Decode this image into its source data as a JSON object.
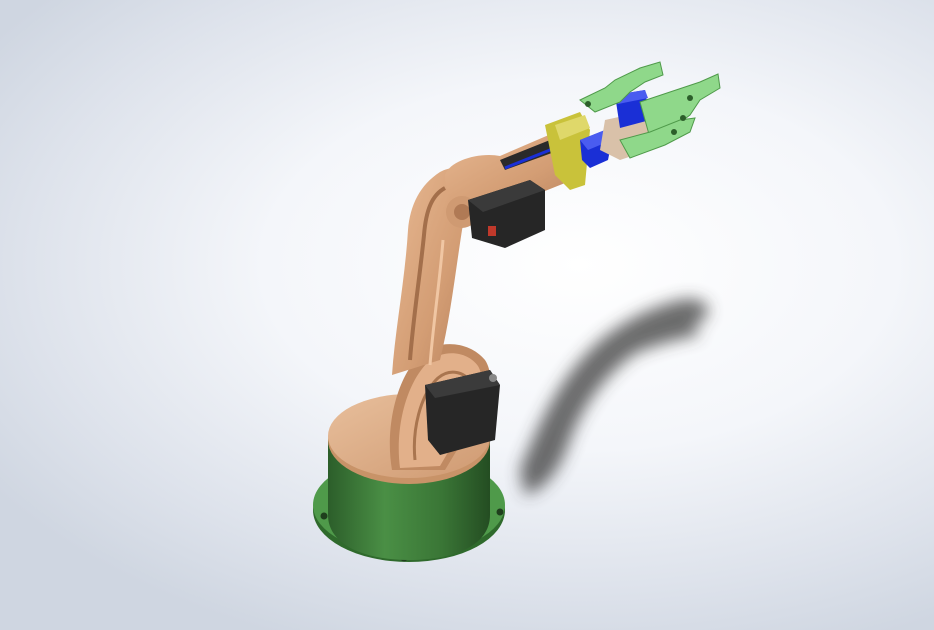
{
  "scene": {
    "background_top": "#ffffff",
    "background_edge": "#cfd6e1",
    "colors": {
      "base_green": "#3e7d3a",
      "base_green_dark": "#2c5e2a",
      "flange_green": "#4f9a4a",
      "arm_wood": "#d9a57d",
      "arm_wood_dark": "#b8825d",
      "servo_black": "#262626",
      "gripper_green": "#8fd88a",
      "servo_blue": "#1a2fd6",
      "wrist_yellow": "#c9c23a"
    },
    "icons": [
      "robot-arm-model"
    ]
  }
}
